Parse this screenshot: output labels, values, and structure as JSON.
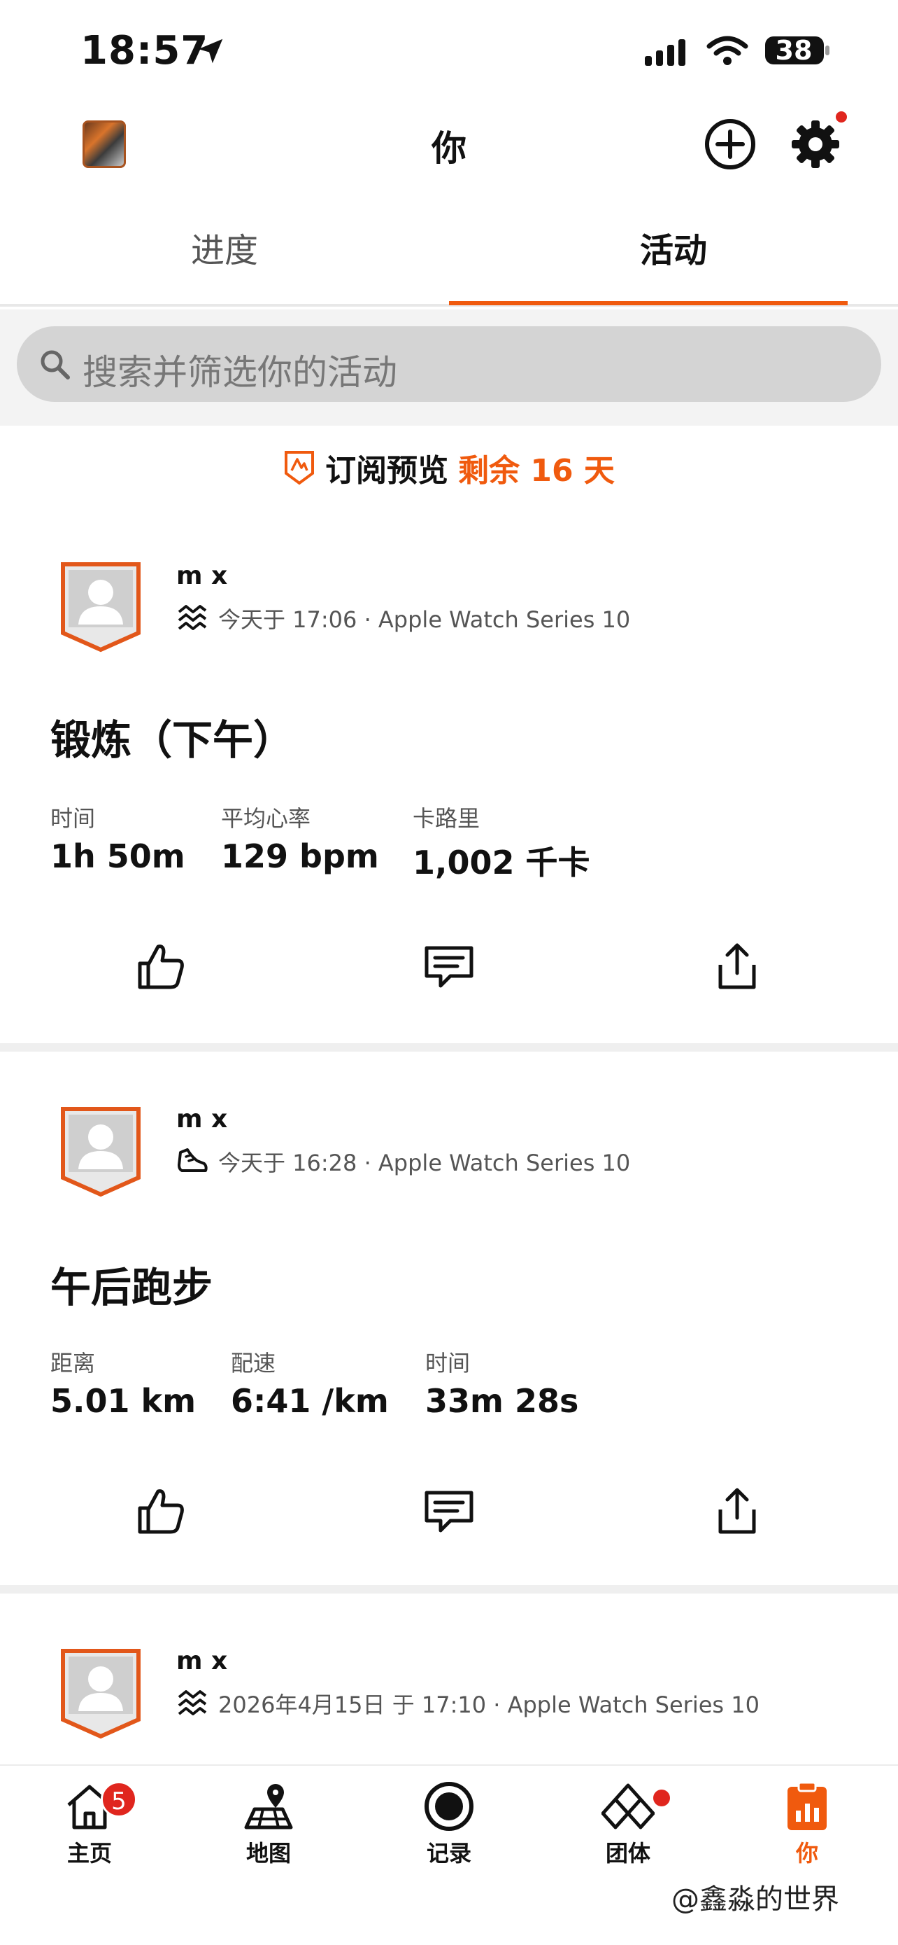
{
  "status_bar": {
    "time": "18:57",
    "battery": "38"
  },
  "header": {
    "title": "你"
  },
  "tabs": [
    {
      "label": "进度",
      "active": false
    },
    {
      "label": "活动",
      "active": true
    }
  ],
  "search": {
    "placeholder": "搜索并筛选你的活动"
  },
  "subscription": {
    "label": "订阅预览",
    "remaining": "剩余 16 天"
  },
  "activities": [
    {
      "name": "m x",
      "meta": "今天于 17:06 · Apple Watch Series 10",
      "type_icon": "workout-icon",
      "title": "锻炼（下午）",
      "stats": [
        {
          "label": "时间",
          "value": "1h 50m"
        },
        {
          "label": "平均心率",
          "value": "129 bpm"
        },
        {
          "label": "卡路里",
          "value": "1,002 千卡"
        }
      ]
    },
    {
      "name": "m x",
      "meta": "今天于 16:28 · Apple Watch Series 10",
      "type_icon": "run-shoe-icon",
      "title": "午后跑步",
      "stats": [
        {
          "label": "距离",
          "value": "5.01 km"
        },
        {
          "label": "配速",
          "value": "6:41 /km"
        },
        {
          "label": "时间",
          "value": "33m 28s"
        }
      ]
    },
    {
      "name": "m x",
      "meta": "2026年4月15日 于 17:10 · Apple Watch Series 10",
      "type_icon": "workout-icon"
    }
  ],
  "bottom_nav": [
    {
      "label": "主页",
      "icon": "home-icon",
      "badge": "5"
    },
    {
      "label": "地图",
      "icon": "map-icon"
    },
    {
      "label": "记录",
      "icon": "record-icon"
    },
    {
      "label": "团体",
      "icon": "groups-icon",
      "dot": true
    },
    {
      "label": "你",
      "icon": "you-icon",
      "active": true
    }
  ],
  "watermark": "@鑫淼的世界",
  "colors": {
    "accent": "#f05a0e",
    "badge": "#e0261e"
  }
}
